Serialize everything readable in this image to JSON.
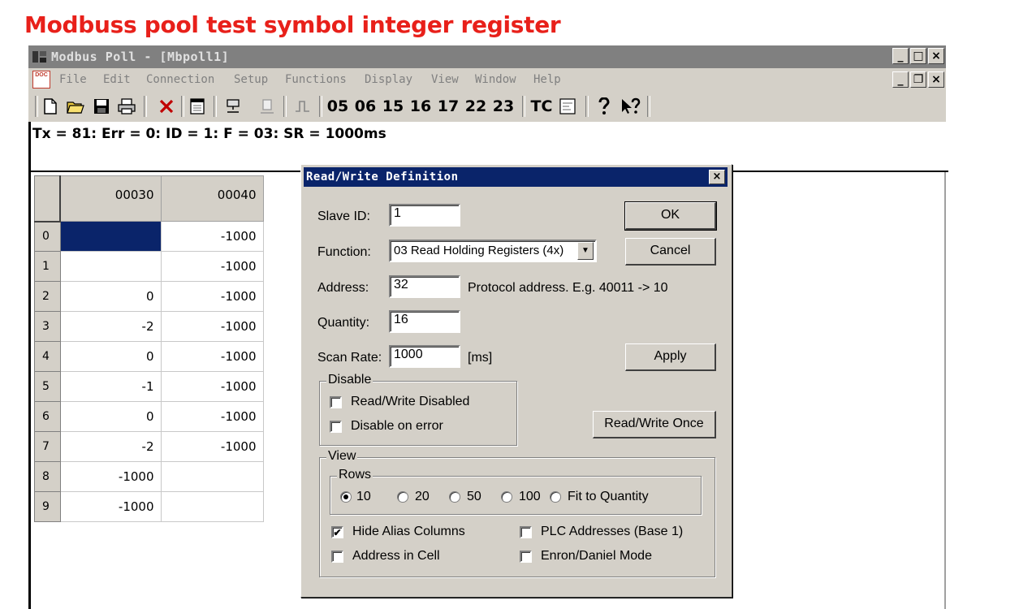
{
  "heading": "Modbuss pool test symbol integer register",
  "window": {
    "title": "Modbus Poll - [Mbpoll1]",
    "min": "_",
    "max": "□",
    "close": "×",
    "restore": "❐"
  },
  "menu": [
    "File",
    "Edit",
    "Connection",
    "Setup",
    "Functions",
    "Display",
    "View",
    "Window",
    "Help"
  ],
  "menu_icon_text": "DOC",
  "toolbar": {
    "function_codes": [
      "05",
      "06",
      "15",
      "16",
      "17",
      "22",
      "23"
    ],
    "tc": "TC"
  },
  "status": "Tx = 81: Err = 0: ID = 1: F = 03: SR = 1000ms",
  "grid": {
    "columns": [
      "00030",
      "00040"
    ],
    "rows": [
      {
        "idx": "0",
        "a": "",
        "b": "-1000"
      },
      {
        "idx": "1",
        "a": "",
        "b": "-1000"
      },
      {
        "idx": "2",
        "a": "0",
        "b": "-1000"
      },
      {
        "idx": "3",
        "a": "-2",
        "b": "-1000"
      },
      {
        "idx": "4",
        "a": "0",
        "b": "-1000"
      },
      {
        "idx": "5",
        "a": "-1",
        "b": "-1000"
      },
      {
        "idx": "6",
        "a": "0",
        "b": "-1000"
      },
      {
        "idx": "7",
        "a": "-2",
        "b": "-1000"
      },
      {
        "idx": "8",
        "a": "-1000",
        "b": ""
      },
      {
        "idx": "9",
        "a": "-1000",
        "b": ""
      }
    ]
  },
  "dialog": {
    "title": "Read/Write Definition",
    "close": "×",
    "slave_id_label": "Slave ID:",
    "slave_id": "1",
    "function_label": "Function:",
    "function": "03 Read Holding Registers (4x)",
    "address_label": "Address:",
    "address": "32",
    "address_hint": "Protocol address. E.g. 40011 -> 10",
    "quantity_label": "Quantity:",
    "quantity": "16",
    "scan_rate_label": "Scan Rate:",
    "scan_rate": "1000",
    "scan_unit": "[ms]",
    "ok": "OK",
    "cancel": "Cancel",
    "apply": "Apply",
    "rw_once": "Read/Write Once",
    "disable_group": "Disable",
    "rw_disabled": "Read/Write Disabled",
    "disable_on_error": "Disable on error",
    "view_group": "View",
    "rows_group": "Rows",
    "rows_options": [
      "10",
      "20",
      "50",
      "100",
      "Fit to Quantity"
    ],
    "rows_selected": "10",
    "hide_alias": "Hide Alias Columns",
    "hide_alias_checked": true,
    "plc_addresses": "PLC Addresses (Base 1)",
    "address_in_cell": "Address in Cell",
    "enron": "Enron/Daniel Mode"
  }
}
